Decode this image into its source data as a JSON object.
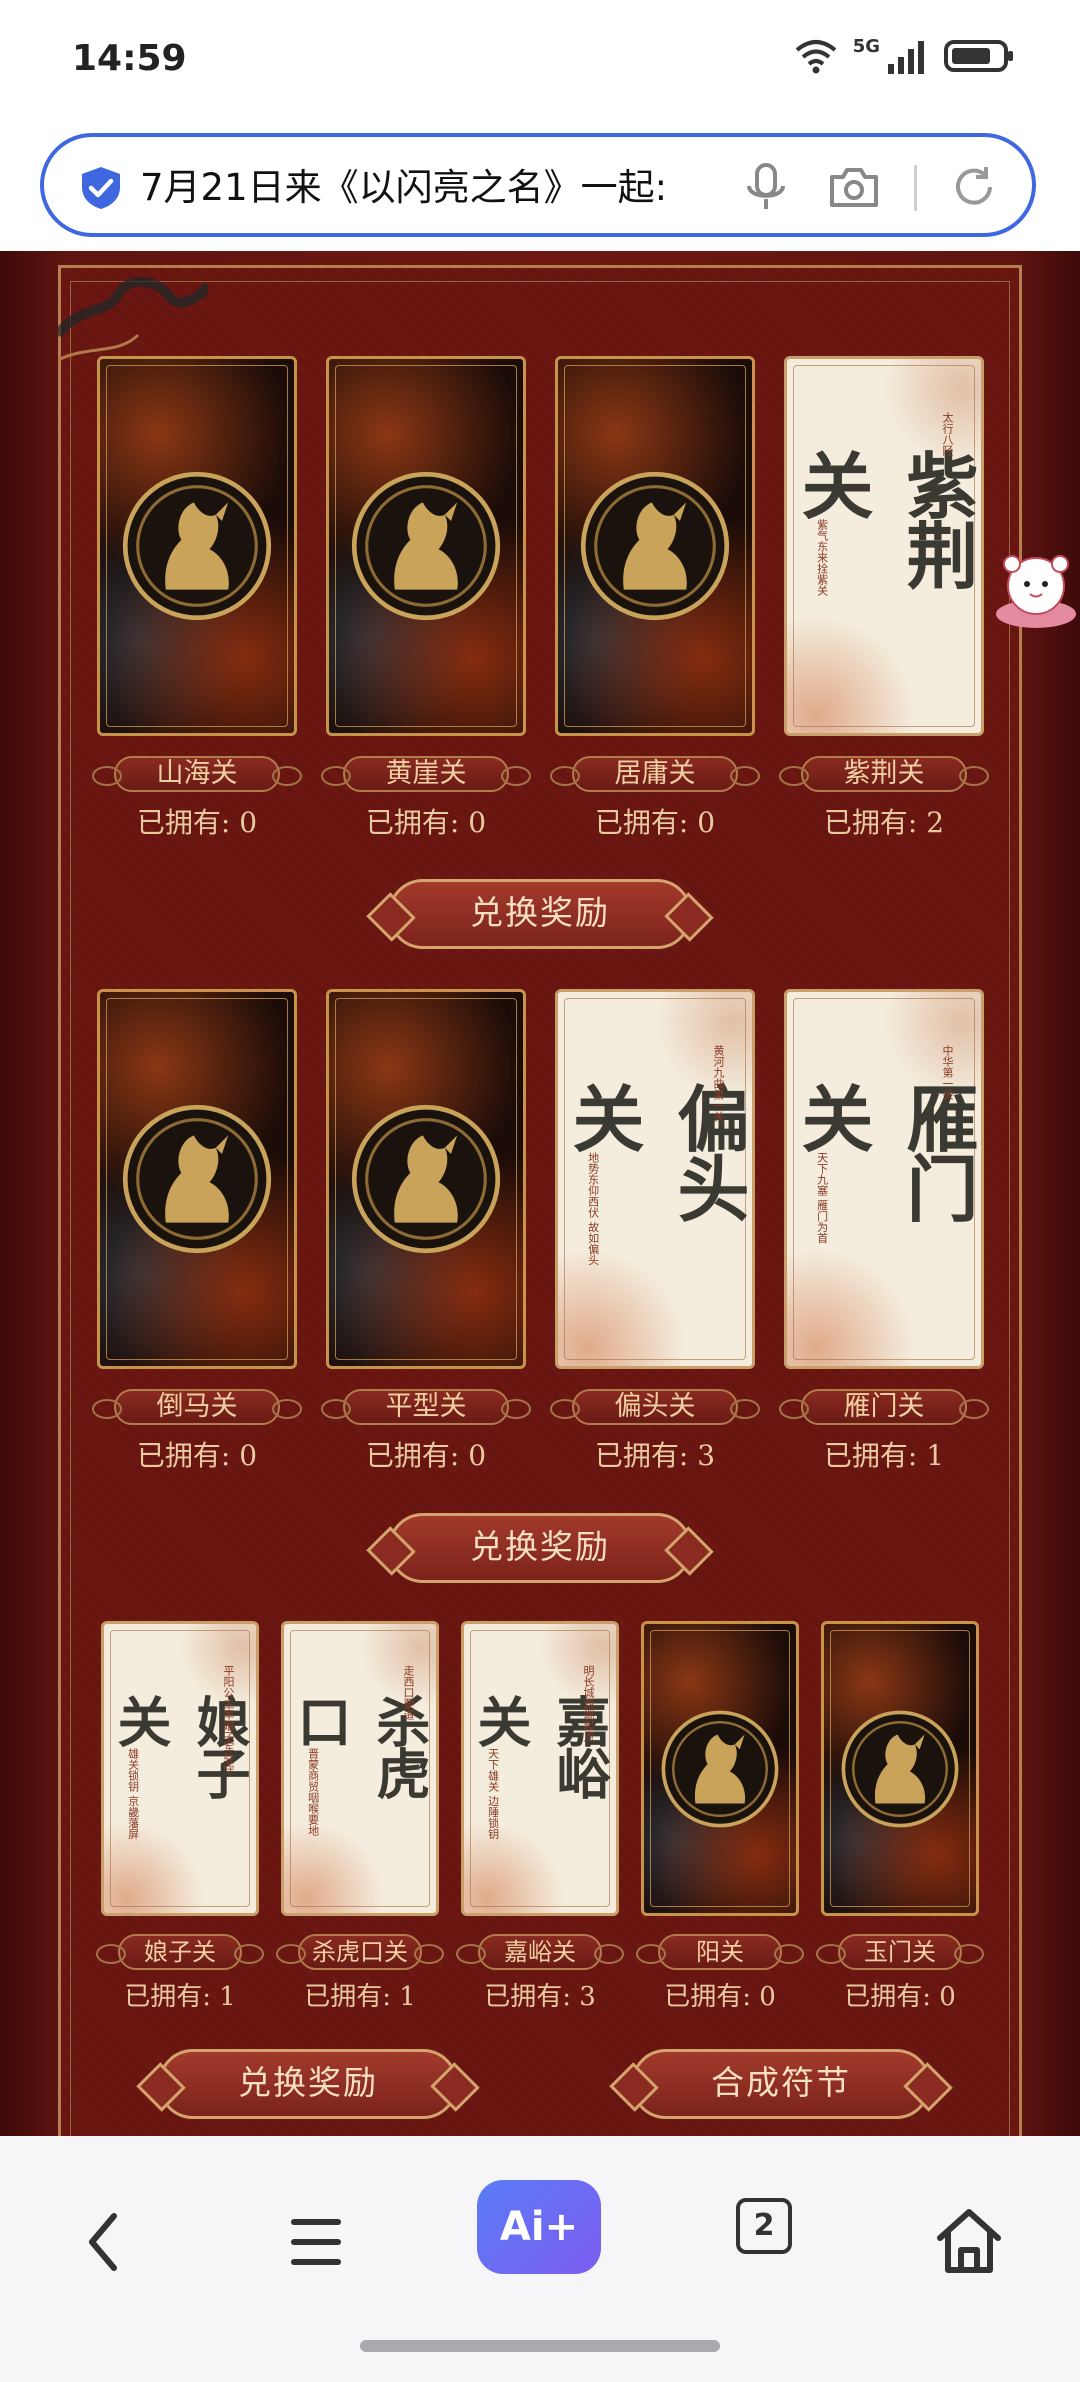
{
  "status_bar": {
    "time": "14:59",
    "network": "5G"
  },
  "address_bar": {
    "url_text": "7月21日来《以闪亮之名》一起:"
  },
  "rows": [
    {
      "cards": [
        {
          "name": "山海关",
          "owned": "已拥有: 0",
          "style": "dark"
        },
        {
          "name": "黄崖关",
          "owned": "已拥有: 0",
          "style": "dark"
        },
        {
          "name": "居庸关",
          "owned": "已拥有: 0",
          "style": "dark"
        },
        {
          "name": "紫荆关",
          "owned": "已拥有: 2",
          "style": "light",
          "calligraphy": "紫荆关",
          "sub1": "太行八陉",
          "sub2": "紫气东来拴紫关"
        }
      ],
      "buttons": [
        "兑换奖励"
      ]
    },
    {
      "cards": [
        {
          "name": "倒马关",
          "owned": "已拥有: 0",
          "style": "dark"
        },
        {
          "name": "平型关",
          "owned": "已拥有: 0",
          "style": "dark"
        },
        {
          "name": "偏头关",
          "owned": "已拥有: 3",
          "style": "light",
          "calligraphy": "偏头关",
          "sub1": "黄河九曲第一关",
          "sub2": "地势东仰西伏 故如偏头"
        },
        {
          "name": "雁门关",
          "owned": "已拥有: 1",
          "style": "light",
          "calligraphy": "雁门关",
          "sub1": "中华第一关",
          "sub2": "天下九塞 雁门为首"
        }
      ],
      "buttons": [
        "兑换奖励"
      ]
    },
    {
      "cards": [
        {
          "name": "娘子关",
          "owned": "已拥有: 1",
          "style": "light",
          "calligraphy": "娘子关",
          "sub1": "平阳公主率娘子军驻守",
          "sub2": "雄关锁钥 京畿藩屏"
        },
        {
          "name": "杀虎口关",
          "owned": "已拥有: 1",
          "style": "light",
          "calligraphy": "杀虎口",
          "sub1": "走西口要道",
          "sub2": "晋蒙商贸咽喉要地"
        },
        {
          "name": "嘉峪关",
          "owned": "已拥有: 3",
          "style": "light",
          "calligraphy": "嘉峪关",
          "sub1": "明长城西端起点",
          "sub2": "天下雄关 边陲锁钥"
        },
        {
          "name": "阳关",
          "owned": "已拥有: 0",
          "style": "dark"
        },
        {
          "name": "玉门关",
          "owned": "已拥有: 0",
          "style": "dark"
        }
      ],
      "buttons": [
        "兑换奖励",
        "合成符节"
      ]
    }
  ],
  "bottom_nav": {
    "ai_label": "Ai+",
    "tabs_count": "2"
  },
  "colors": {
    "accent": "#3f67e0",
    "panel": "#6c1712",
    "gold": "#c7944a"
  }
}
